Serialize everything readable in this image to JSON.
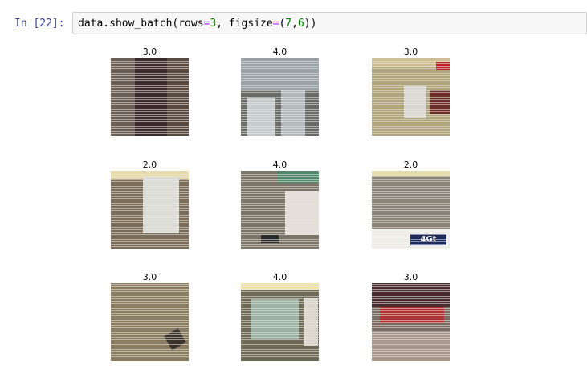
{
  "cell": {
    "prompt": "In [22]:",
    "code_parts": [
      "data.show_batch(rows",
      "=",
      "3",
      ", figsize",
      "=",
      "(",
      "7",
      ",",
      "6",
      "))"
    ]
  },
  "batch": {
    "labels": [
      "3.0",
      "4.0",
      "3.0",
      "2.0",
      "4.0",
      "2.0",
      "3.0",
      "4.0",
      "3.0"
    ],
    "badge_text": [
      "4Gt"
    ],
    "colors": {
      "background": "#ffffff",
      "prompt": "#303f9f",
      "code_bg": "#f7f7f7",
      "number_token": "#008000",
      "operator_token": "#aa22ff"
    }
  }
}
